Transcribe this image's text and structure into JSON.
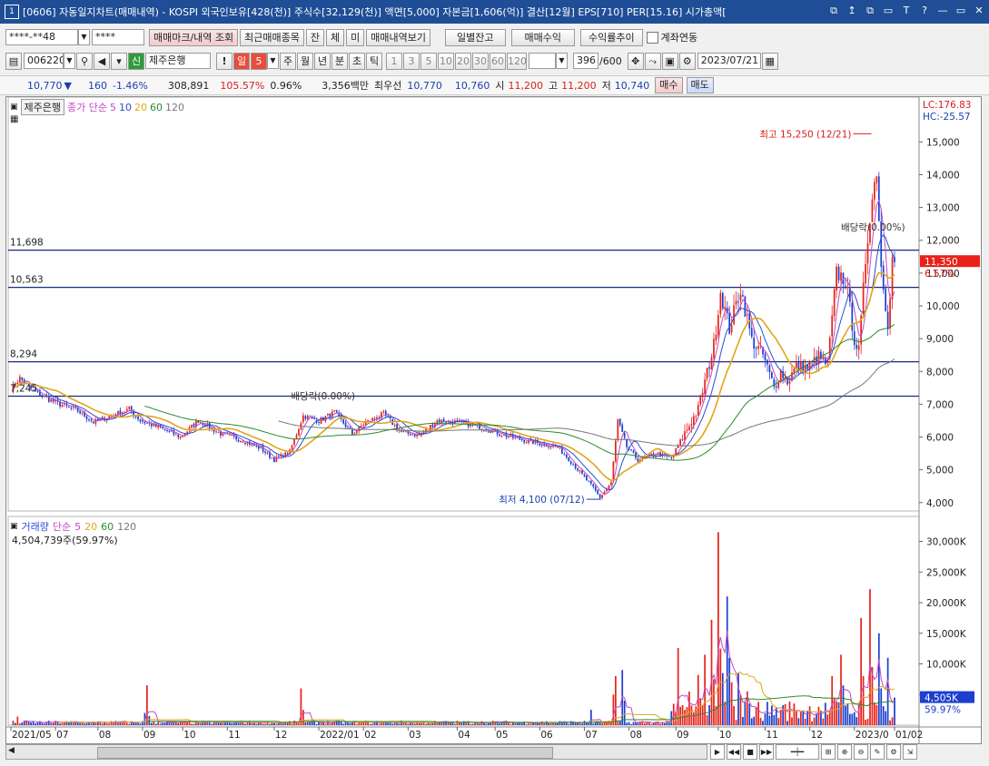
{
  "window": {
    "icon": "1",
    "title": "[0606] 자동일지차트(매매내역) - KOSPI 외국인보유[428(천)] 주식수[32,129(천)] 액면[5,000] 자본금[1,606(억)] 결산[12월] EPS[710] PER[15.16] 시가총액[",
    "buttons": [
      "⧉",
      "↥",
      "⧉",
      "▭",
      "T",
      "?",
      "—",
      "▭",
      "✕"
    ]
  },
  "toolbar1": {
    "account": "****-**48",
    "password": "****",
    "btn_trade_mark": "매매마크/내역 조회",
    "btn_recent": "최근매매종목",
    "btn_jan": "잔",
    "btn_che": "체",
    "btn_mi": "미",
    "btn_history": "매매내역보기",
    "btn_daily_balance": "일별잔고",
    "btn_profit": "매매수익",
    "btn_return_trend": "수익률추이",
    "chk_account_link": "계좌연동"
  },
  "toolbar2": {
    "code": "006220",
    "badge": "신",
    "name": "제주은행",
    "periods": [
      "일",
      "5",
      "주",
      "월",
      "년",
      "분",
      "초",
      "틱"
    ],
    "nums": [
      "1",
      "3",
      "5",
      "10",
      "20",
      "30",
      "60",
      "120"
    ],
    "count": "396",
    "count_total": "/600",
    "date": "2023/07/21"
  },
  "quote": {
    "price": "10,770",
    "change": "160",
    "change_pct": "-1.46%",
    "volume": "308,891",
    "vol_ratio": "105.57%",
    "turnover": "0.96%",
    "amount": "3,356백만",
    "best_ask_label": "최우선",
    "best_ask": "10,770",
    "best_bid": "10,760",
    "open_label": "시",
    "open": "11,200",
    "high_label": "고",
    "high": "11,200",
    "low_label": "저",
    "low": "10,740",
    "buy_label": "매수",
    "sell_label": "매도"
  },
  "colors": {
    "up": "#e8221a",
    "down": "#1c3fcf",
    "ma5": "#c04ac4",
    "ma10": "#2a4fd0",
    "ma20": "#e1a51b",
    "ma60": "#2d8a2d",
    "ma120": "#777777",
    "hline": "#1a2a7a"
  },
  "chart_data": [
    {
      "type": "candlestick",
      "stock_label": "제주은행",
      "indicator_legend": [
        "종가 단순",
        "5",
        "10",
        "20",
        "60",
        "120"
      ],
      "ylim": [
        3800,
        16200
      ],
      "y_ticks": [
        "4,000",
        "5,000",
        "6,000",
        "7,000",
        "8,000",
        "9,000",
        "10,000",
        "11,000",
        "12,000",
        "13,000",
        "14,000",
        "15,000"
      ],
      "x_ticks": [
        "2021/05",
        "07",
        "08",
        "09",
        "10",
        "11",
        "12",
        "2022/01",
        "02",
        "03",
        "04",
        "05",
        "06",
        "07",
        "08",
        "09",
        "10",
        "11",
        "12",
        "2023/0",
        "01/02"
      ],
      "corner_labels": [
        "LC:176.83",
        "HC:-25.57"
      ],
      "current_price": "11,350",
      "current_change": "6.57%",
      "hlines": [
        {
          "label": "11,698",
          "value": 11698
        },
        {
          "label": "10,563",
          "value": 10563
        },
        {
          "label": "8,294",
          "value": 8294
        },
        {
          "label": "7,245",
          "value": 7245
        }
      ],
      "annotations": {
        "high": "최고 15,250 (12/21)",
        "low": "최저 4,100 (07/12)",
        "div1": "배당락(0.00%)",
        "div2": "배당락(0.00%)"
      },
      "anchors": [
        [
          0,
          7450
        ],
        [
          4,
          7800
        ],
        [
          10,
          7400
        ],
        [
          20,
          7050
        ],
        [
          30,
          6800
        ],
        [
          37,
          6450
        ],
        [
          45,
          6650
        ],
        [
          53,
          6850
        ],
        [
          58,
          6500
        ],
        [
          66,
          6300
        ],
        [
          76,
          6000
        ],
        [
          84,
          6500
        ],
        [
          94,
          6100
        ],
        [
          104,
          5900
        ],
        [
          112,
          5650
        ],
        [
          118,
          5300
        ],
        [
          125,
          5550
        ],
        [
          131,
          6650
        ],
        [
          138,
          6500
        ],
        [
          145,
          6750
        ],
        [
          153,
          6100
        ],
        [
          159,
          6450
        ],
        [
          167,
          6700
        ],
        [
          175,
          6150
        ],
        [
          183,
          6050
        ],
        [
          191,
          6500
        ],
        [
          201,
          6450
        ],
        [
          211,
          6300
        ],
        [
          221,
          6050
        ],
        [
          233,
          5850
        ],
        [
          245,
          5700
        ],
        [
          251,
          5250
        ],
        [
          261,
          4450
        ],
        [
          264,
          4150
        ],
        [
          269,
          4600
        ],
        [
          272,
          6500
        ],
        [
          276,
          5700
        ],
        [
          281,
          5300
        ],
        [
          289,
          5500
        ],
        [
          296,
          5350
        ],
        [
          301,
          6000
        ],
        [
          308,
          6850
        ],
        [
          315,
          8800
        ],
        [
          318,
          10450
        ],
        [
          322,
          9300
        ],
        [
          327,
          10550
        ],
        [
          332,
          8950
        ],
        [
          337,
          8500
        ],
        [
          342,
          7500
        ],
        [
          345,
          8000
        ],
        [
          348,
          7700
        ],
        [
          352,
          8150
        ],
        [
          357,
          8100
        ],
        [
          362,
          8450
        ],
        [
          366,
          8200
        ],
        [
          368,
          9600
        ],
        [
          370,
          11000
        ],
        [
          374,
          10800
        ],
        [
          378,
          9000
        ],
        [
          380,
          8600
        ],
        [
          383,
          11400
        ],
        [
          385,
          12800
        ],
        [
          388,
          14200
        ],
        [
          390,
          11200
        ],
        [
          393,
          9500
        ],
        [
          395,
          11400
        ],
        [
          396,
          11350
        ]
      ],
      "volume_panel": {
        "legend": [
          "거래량",
          "단순",
          "5",
          "20",
          "60",
          "120"
        ],
        "last_volume": "4,504,739주(59.97%)",
        "ylim": [
          0,
          32000
        ],
        "y_ticks": [
          "5,000K",
          "10,000K",
          "15,000K",
          "20,000K",
          "25,000K",
          "30,000K"
        ],
        "current_volume": "4,505K",
        "current_pct": "59.97%",
        "spikes": [
          [
            3,
            1400
          ],
          [
            8,
            700
          ],
          [
            60,
            2000
          ],
          [
            61,
            6500
          ],
          [
            62,
            1500
          ],
          [
            130,
            6000
          ],
          [
            131,
            2500
          ],
          [
            260,
            2500
          ],
          [
            270,
            5000
          ],
          [
            271,
            8000
          ],
          [
            274,
            9000
          ],
          [
            275,
            4000
          ],
          [
            298,
            2200
          ],
          [
            299,
            12600
          ],
          [
            300,
            3000
          ],
          [
            304,
            5500
          ],
          [
            305,
            3200
          ],
          [
            308,
            8200
          ],
          [
            309,
            4400
          ],
          [
            311,
            11500
          ],
          [
            314,
            17200
          ],
          [
            315,
            7500
          ],
          [
            317,
            31500
          ],
          [
            318,
            12500
          ],
          [
            319,
            8500
          ],
          [
            321,
            21000
          ],
          [
            322,
            11000
          ],
          [
            323,
            7000
          ],
          [
            326,
            8500
          ],
          [
            327,
            5000
          ],
          [
            330,
            5500
          ],
          [
            331,
            3500
          ],
          [
            345,
            2500
          ],
          [
            362,
            3000
          ],
          [
            368,
            8000
          ],
          [
            369,
            4500
          ],
          [
            372,
            11500
          ],
          [
            373,
            6500
          ],
          [
            381,
            17500
          ],
          [
            382,
            8000
          ],
          [
            385,
            22200
          ],
          [
            386,
            9500
          ],
          [
            389,
            15000
          ],
          [
            390,
            6000
          ],
          [
            393,
            11000
          ],
          [
            396,
            4505
          ]
        ]
      }
    }
  ]
}
